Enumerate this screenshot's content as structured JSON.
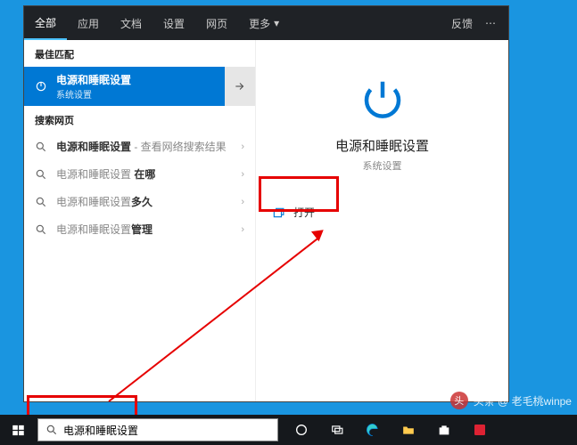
{
  "header": {
    "tabs": [
      "全部",
      "应用",
      "文档",
      "设置",
      "网页"
    ],
    "more": "更多",
    "feedback": "反馈"
  },
  "left": {
    "best_label": "最佳匹配",
    "best_title": "电源和睡眠设置",
    "best_sub": "系统设置",
    "web_label": "搜索网页",
    "items": [
      {
        "prefix": "电源和睡眠设置",
        "suffix": " - 查看网络搜索结果"
      },
      {
        "prefix": "电源和睡眠设置",
        "suffix": " 在哪"
      },
      {
        "prefix": "电源和睡眠设置",
        "suffix": "多久"
      },
      {
        "prefix": "电源和睡眠设置",
        "suffix": "管理"
      }
    ]
  },
  "right": {
    "title": "电源和睡眠设置",
    "sub": "系统设置",
    "open": "打开"
  },
  "search": {
    "value": "电源和睡眠设置"
  },
  "watermark": "头条 @ 老毛桃winpe"
}
